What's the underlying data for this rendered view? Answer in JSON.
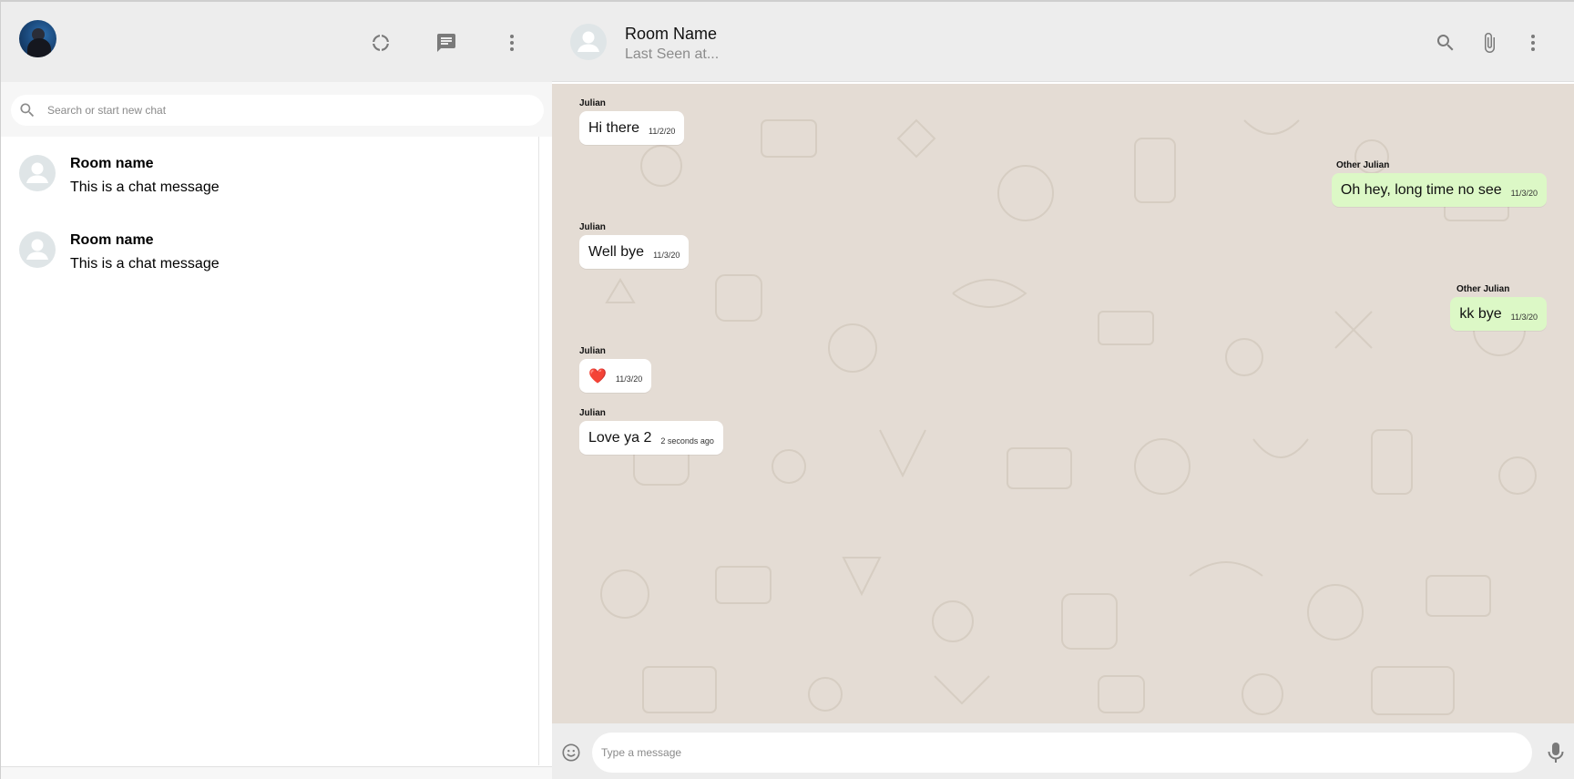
{
  "sidebar": {
    "profile_avatar": "profile-photo",
    "header_icons": [
      "status-icon",
      "new-chat-icon",
      "more-vert-icon"
    ],
    "search": {
      "placeholder": "Search or start new chat"
    },
    "chats": [
      {
        "name": "Room name",
        "last_message": "This is a chat message"
      },
      {
        "name": "Room name",
        "last_message": "This is a chat message"
      }
    ]
  },
  "chat": {
    "header": {
      "room_name": "Room Name",
      "last_seen": "Last Seen at..."
    },
    "header_icons": [
      "search-icon",
      "attach-icon",
      "more-vert-icon"
    ],
    "messages": [
      {
        "sender": "Julian",
        "text": "Hi there",
        "time": "11/2/20",
        "direction": "in"
      },
      {
        "sender": "Other Julian",
        "text": "Oh hey, long time no see",
        "time": "11/3/20",
        "direction": "out"
      },
      {
        "sender": "Julian",
        "text": "Well bye",
        "time": "11/3/20",
        "direction": "in"
      },
      {
        "sender": "Other Julian",
        "text": "kk bye",
        "time": "11/3/20",
        "direction": "out"
      },
      {
        "sender": "Julian",
        "text": "❤️",
        "time": "11/3/20",
        "direction": "in"
      },
      {
        "sender": "Julian",
        "text": "Love ya 2",
        "time": "2 seconds ago",
        "direction": "in"
      }
    ],
    "footer": {
      "input_placeholder": "Type a message",
      "emoji_icon": "emoji-icon",
      "mic_icon": "mic-icon"
    }
  },
  "colors": {
    "header_bg": "#ededed",
    "chat_bg": "#e4dcd4",
    "incoming_bubble": "#ffffff",
    "outgoing_bubble": "#dcf8c6",
    "icon": "#919191"
  }
}
